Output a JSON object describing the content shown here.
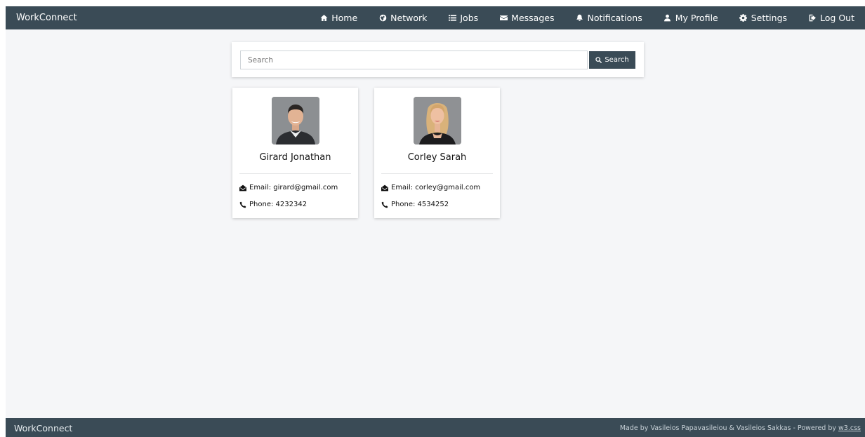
{
  "navbar": {
    "brand": "WorkConnect",
    "items": [
      {
        "label": "Home",
        "icon": "home-icon"
      },
      {
        "label": "Network",
        "icon": "globe-icon"
      },
      {
        "label": "Jobs",
        "icon": "list-icon"
      },
      {
        "label": "Messages",
        "icon": "envelope-icon"
      },
      {
        "label": "Notifications",
        "icon": "bell-icon"
      },
      {
        "label": "My Profile",
        "icon": "user-icon"
      },
      {
        "label": "Settings",
        "icon": "gear-icon"
      },
      {
        "label": "Log Out",
        "icon": "logout-icon"
      }
    ]
  },
  "search": {
    "placeholder": "Search",
    "value": "",
    "button_label": "Search"
  },
  "users": [
    {
      "name": "Girard Jonathan",
      "email": "Email: girard@gmail.com",
      "phone": "Phone: 4232342"
    },
    {
      "name": "Corley Sarah",
      "email": "Email: corley@gmail.com",
      "phone": "Phone: 4534252"
    }
  ],
  "footer": {
    "brand": "WorkConnect",
    "credits_prefix": "Made by Vasileios Papavasileiou & Vasileios Sakkas - Powered by ",
    "credits_link": "w3.css"
  },
  "colors": {
    "navbar_bg": "#3a4b56",
    "page_bg": "#f5f6f8",
    "card_bg": "#ffffff"
  }
}
